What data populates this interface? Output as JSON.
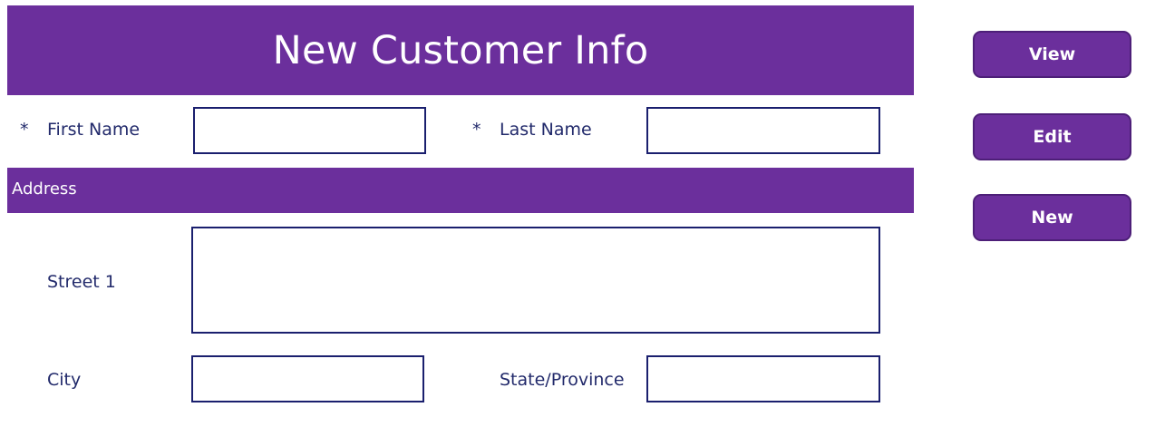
{
  "form": {
    "title": "New Customer Info",
    "required_marker": "*",
    "fields": {
      "first_name": {
        "label": "First Name",
        "value": ""
      },
      "last_name": {
        "label": "Last Name",
        "value": ""
      },
      "street1": {
        "label": "Street 1",
        "value": ""
      },
      "city": {
        "label": "City",
        "value": ""
      },
      "state_province": {
        "label": "State/Province",
        "value": ""
      }
    },
    "sections": {
      "address": "Address"
    }
  },
  "actions": {
    "view_label": "View",
    "edit_label": "Edit",
    "new_label": "New"
  },
  "colors": {
    "brand_purple": "#6b2f9c",
    "button_border": "#4d1f78",
    "field_border": "#1a1f6e",
    "label_text": "#222a6b"
  }
}
